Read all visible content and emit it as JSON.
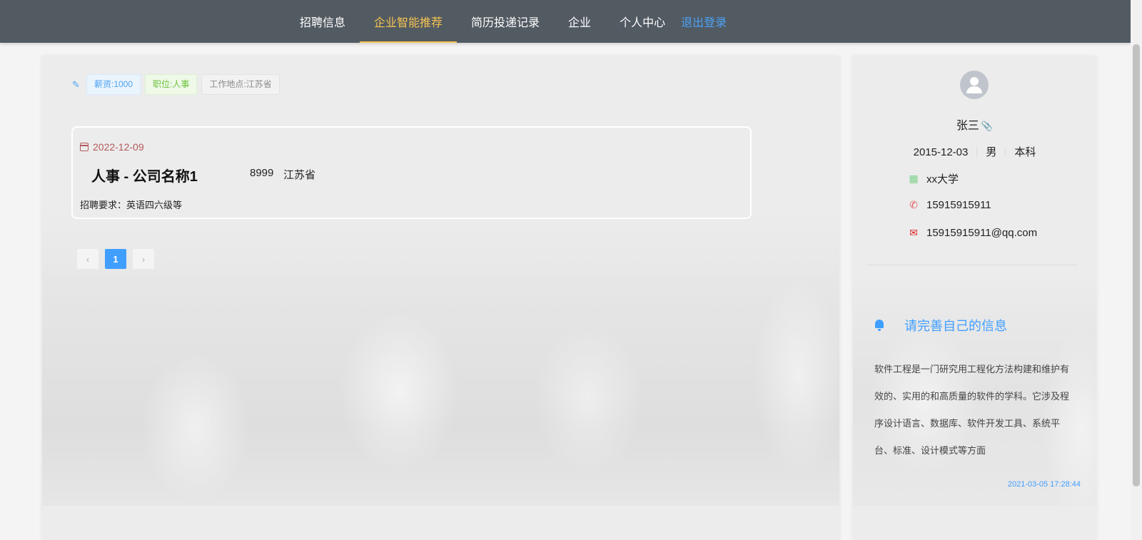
{
  "nav": {
    "items": [
      {
        "label": "招聘信息",
        "active": false
      },
      {
        "label": "企业智能推荐",
        "active": true
      },
      {
        "label": "简历投递记录",
        "active": false
      },
      {
        "label": "企业",
        "active": false
      },
      {
        "label": "个人中心",
        "active": false
      }
    ],
    "logout": "退出登录"
  },
  "filters": {
    "icon": "edit-icon",
    "salary": "薪资:1000",
    "position": "职位:人事",
    "location": "工作地点:江苏省"
  },
  "job": {
    "date": "2022-12-09",
    "title": "人事 - 公司名称1",
    "salary": "8999",
    "location": "江苏省",
    "requirement": "招聘要求：英语四六级等"
  },
  "pagination": {
    "prev": "‹",
    "current": "1",
    "next": "›"
  },
  "profile": {
    "name": "张三",
    "birth": "2015-12-03",
    "gender": "男",
    "degree": "本科",
    "school": "xx大学",
    "phone": "15915915911",
    "email": "15915915911@qq.com"
  },
  "notice": {
    "title": "请完善自己的信息",
    "body": "软件工程是一门研究用工程化方法构建和维护有效的、实用的和高质量的软件的学科。它涉及程序设计语言、数据库、软件开发工具、系统平台、标准、设计模式等方面",
    "time": "2021-03-05 17:28:44"
  },
  "colors": {
    "nav_bg": "#525a62",
    "nav_active": "#f5c452",
    "logout": "#4ca3f5",
    "accent": "#409eff",
    "date": "#b35a5a"
  }
}
